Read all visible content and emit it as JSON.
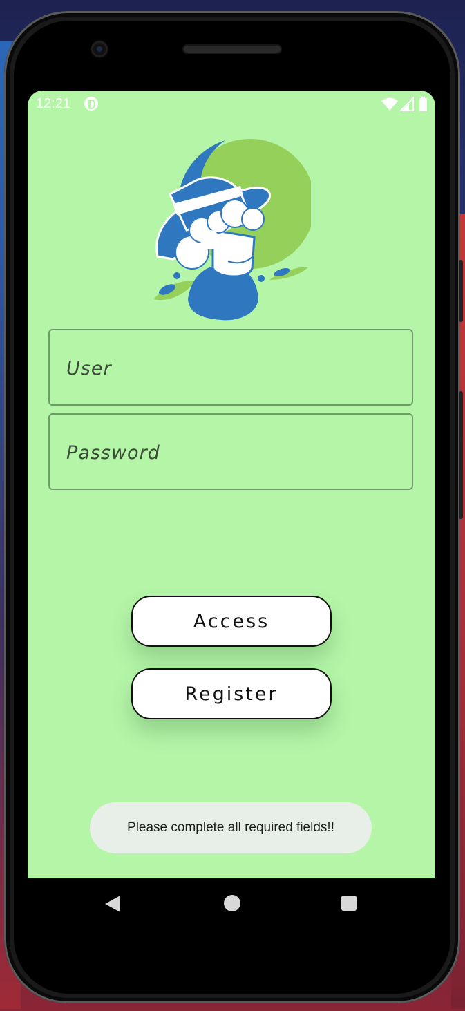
{
  "status_bar": {
    "time": "12:21"
  },
  "login": {
    "user_placeholder": "User",
    "password_placeholder": "Password",
    "access_label": "Access",
    "register_label": "Register"
  },
  "toast": {
    "message": "Please complete all required fields!!"
  },
  "colors": {
    "screen_bg": "#b4f5a8",
    "logo_blue": "#2f78bf",
    "logo_green": "#95d05a",
    "button_bg": "#ffffff",
    "toast_bg": "#e8efe8"
  },
  "icons": {
    "status": [
      "app-notification-icon",
      "wifi-icon",
      "signal-icon",
      "battery-icon"
    ],
    "nav": [
      "back-icon",
      "home-icon",
      "recents-icon"
    ]
  }
}
